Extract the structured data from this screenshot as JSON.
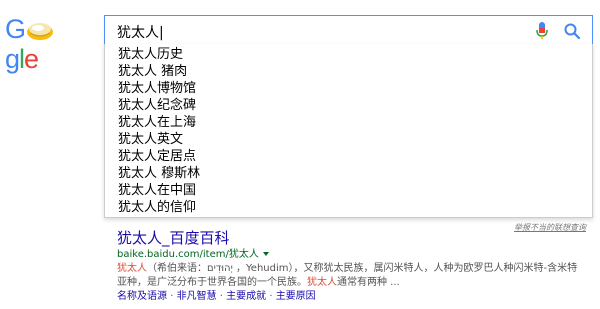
{
  "logo": {
    "letters": [
      "G",
      "g",
      "l",
      "e"
    ],
    "alt": "Google",
    "colors": {
      "blue": "#4285f4",
      "green": "#34a853",
      "red": "#ea4335",
      "yellow": "#fbbc05"
    }
  },
  "search": {
    "query": "犹太人|",
    "mic_icon": "microphone-icon",
    "search_icon": "magnifier-icon",
    "accent_color": "#4d90fe"
  },
  "suggestions": [
    "犹太人历史",
    "犹太人 猪肉",
    "犹太人博物馆",
    "犹太人纪念碑",
    "犹太人在上海",
    "犹太人英文",
    "犹太人定居点",
    "犹太人 穆斯林",
    "犹太人在中国",
    "犹太人的信仰"
  ],
  "report_link": "举报不当的联想查询",
  "result": {
    "title": "犹太人_百度百科",
    "url": "baike.baidu.com/item/犹太人",
    "snippet_line1_hl": "犹太人",
    "snippet_line1_rest": "（希伯来语：יְהוּדִים‎ ，Yehudim），又称犹太民族，属闪米特人，人种为欧罗巴人种闪米特-含米特",
    "snippet_line2_pre": "亚种，是广泛分布于世界各国的一个民族。",
    "snippet_line2_hl": "犹太人",
    "snippet_line2_post": "通常有两种 ...",
    "sitelinks": [
      "名称及语源",
      "非凡智慧",
      "主要成就",
      "主要原因"
    ],
    "sitelink_separator": "·",
    "colors": {
      "title": "#1a0dab",
      "url": "#006621",
      "highlight": "#dd4b39",
      "snippet": "#545454"
    }
  }
}
